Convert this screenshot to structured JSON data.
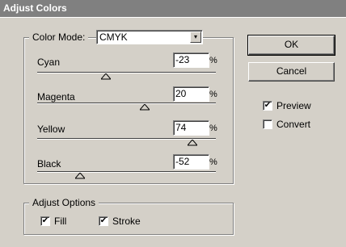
{
  "window": {
    "title": "Adjust Colors"
  },
  "color_mode": {
    "label": "Color Mode:",
    "value": "CMYK"
  },
  "sliders": [
    {
      "label": "Cyan",
      "value": "-23",
      "unit": "%",
      "level": -23
    },
    {
      "label": "Magenta",
      "value": "20",
      "unit": "%",
      "level": 20
    },
    {
      "label": "Yellow",
      "value": "74",
      "unit": "%",
      "level": 74
    },
    {
      "label": "Black",
      "value": "-52",
      "unit": "%",
      "level": -52
    }
  ],
  "buttons": {
    "ok": "OK",
    "cancel": "Cancel"
  },
  "options": {
    "preview": {
      "label": "Preview",
      "checked": true,
      "mark": "✔"
    },
    "convert": {
      "label": "Convert",
      "checked": false,
      "mark": ""
    }
  },
  "adjust_options": {
    "legend": "Adjust Options",
    "fill": {
      "label": "Fill",
      "checked": true,
      "mark": "✔"
    },
    "stroke": {
      "label": "Stroke",
      "checked": true,
      "mark": "✔"
    }
  }
}
